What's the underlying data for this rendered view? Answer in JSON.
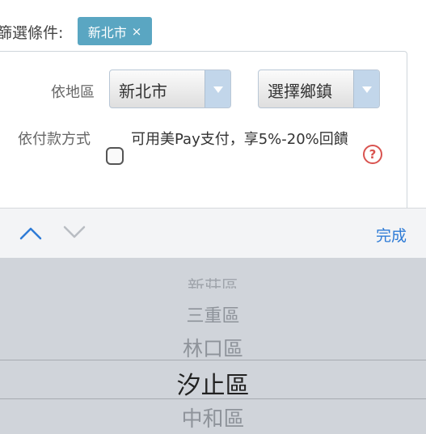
{
  "filter": {
    "label": "篩選條件:",
    "chip_label": "新北市",
    "chip_close": "×"
  },
  "region": {
    "label": "依地區",
    "city_value": "新北市",
    "district_placeholder": "選擇鄉鎮"
  },
  "payment": {
    "label": "依付款方式",
    "option_text": "可用美Pay支付，享5%-20%回饋",
    "help": "?"
  },
  "accessory": {
    "done_label": "完成"
  },
  "picker": {
    "items": [
      "新莊區",
      "三重區",
      "林口區",
      "汐止區",
      "中和區"
    ],
    "selected": "汐止區"
  },
  "colors": {
    "chip_bg": "#5aa6c2",
    "accent": "#2e7bd6",
    "help": "#d9534f",
    "picker_bg": "#d0d4da"
  }
}
